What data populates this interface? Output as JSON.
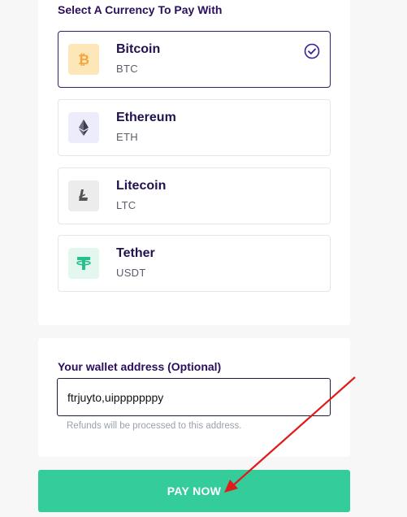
{
  "currency_section": {
    "title": "Select A Currency To Pay With",
    "options": [
      {
        "name": "Bitcoin",
        "code": "BTC",
        "icon": "bitcoin-icon",
        "badge_bg": "#fde6b8",
        "icon_color": "#f3a53a",
        "selected": true
      },
      {
        "name": "Ethereum",
        "code": "ETH",
        "icon": "ethereum-icon",
        "badge_bg": "#ececfb",
        "icon_color": "#3d3d52",
        "selected": false
      },
      {
        "name": "Litecoin",
        "code": "LTC",
        "icon": "litecoin-icon",
        "badge_bg": "#ececec",
        "icon_color": "#555555",
        "selected": false
      },
      {
        "name": "Tether",
        "code": "USDT",
        "icon": "tether-icon",
        "badge_bg": "#e4f7ef",
        "icon_color": "#26c08e",
        "selected": false
      }
    ]
  },
  "wallet_section": {
    "label": "Your wallet address (Optional)",
    "value": "ftrjuyto,uipppppppy",
    "hint": "Refunds will be processed to this address."
  },
  "pay_button": {
    "label": "PAY NOW",
    "color": "#35cc9b"
  },
  "colors": {
    "accent_dark": "#2b0f5c",
    "annotation_arrow": "#e01b1b"
  }
}
